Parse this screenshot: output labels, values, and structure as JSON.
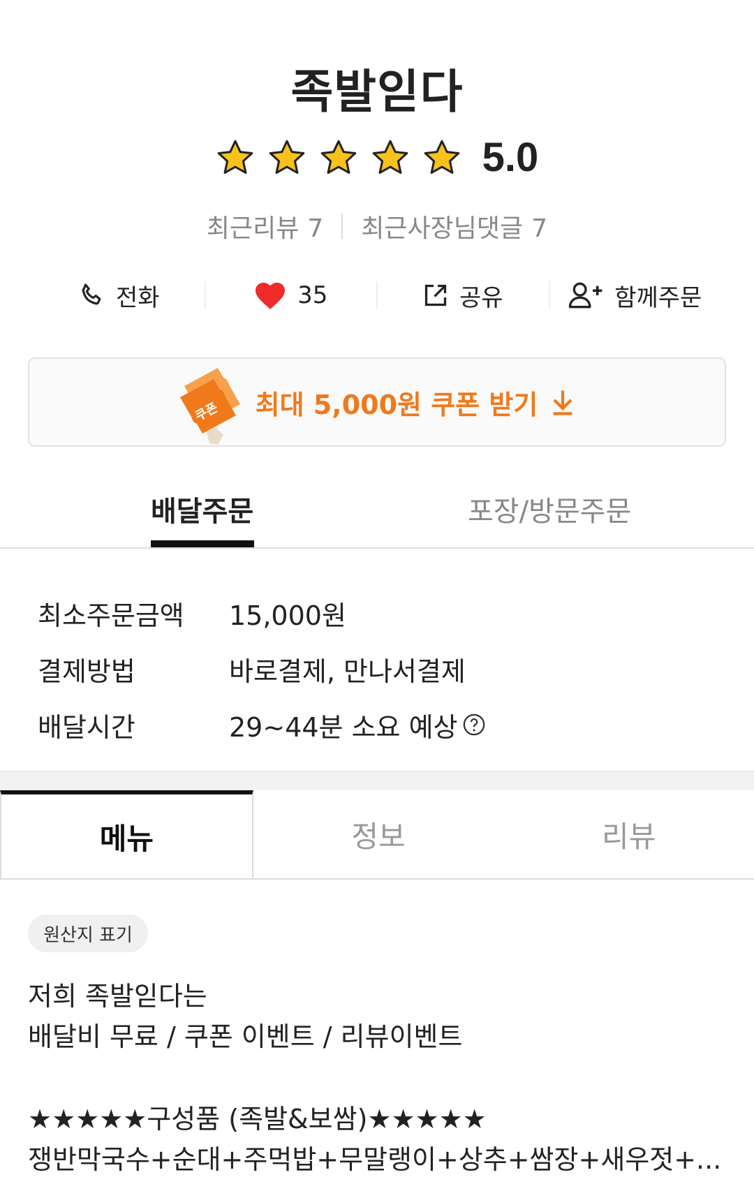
{
  "store": {
    "name": "족발읻다",
    "rating": "5.0",
    "star_count": 5,
    "star_color": "#f7c21b"
  },
  "reviews": {
    "recent_reviews_label": "최근리뷰",
    "recent_reviews_count": "7",
    "owner_comments_label": "최근사장님댓글",
    "owner_comments_count": "7"
  },
  "actions": {
    "call_label": "전화",
    "likes_count": "35",
    "share_label": "공유",
    "group_order_label": "함께주문"
  },
  "coupon": {
    "badge_text": "쿠폰",
    "label": "최대 5,000원 쿠폰 받기",
    "accent_color": "#f0791c"
  },
  "order_tabs": {
    "delivery": "배달주문",
    "pickup": "포장/방문주문"
  },
  "info": {
    "rows": [
      {
        "label": "최소주문금액",
        "value": "15,000원"
      },
      {
        "label": "결제방법",
        "value": "바로결제, 만나서결제"
      },
      {
        "label": "배달시간",
        "value": "29~44분 소요 예상"
      }
    ]
  },
  "main_tabs": {
    "menu": "메뉴",
    "info": "정보",
    "review": "리뷰"
  },
  "origin_chip": "원산지 표기",
  "description": {
    "line1": "저희 족발읻다는",
    "line2": "배달비 무료 / 쿠폰 이벤트 / 리뷰이벤트",
    "line3": "★★★★★구성품 (족발&보쌈)★★★★★",
    "line4": "쟁반막국수+순대+주먹밥+무말랭이+상추+쌈장+새우젓+..."
  }
}
